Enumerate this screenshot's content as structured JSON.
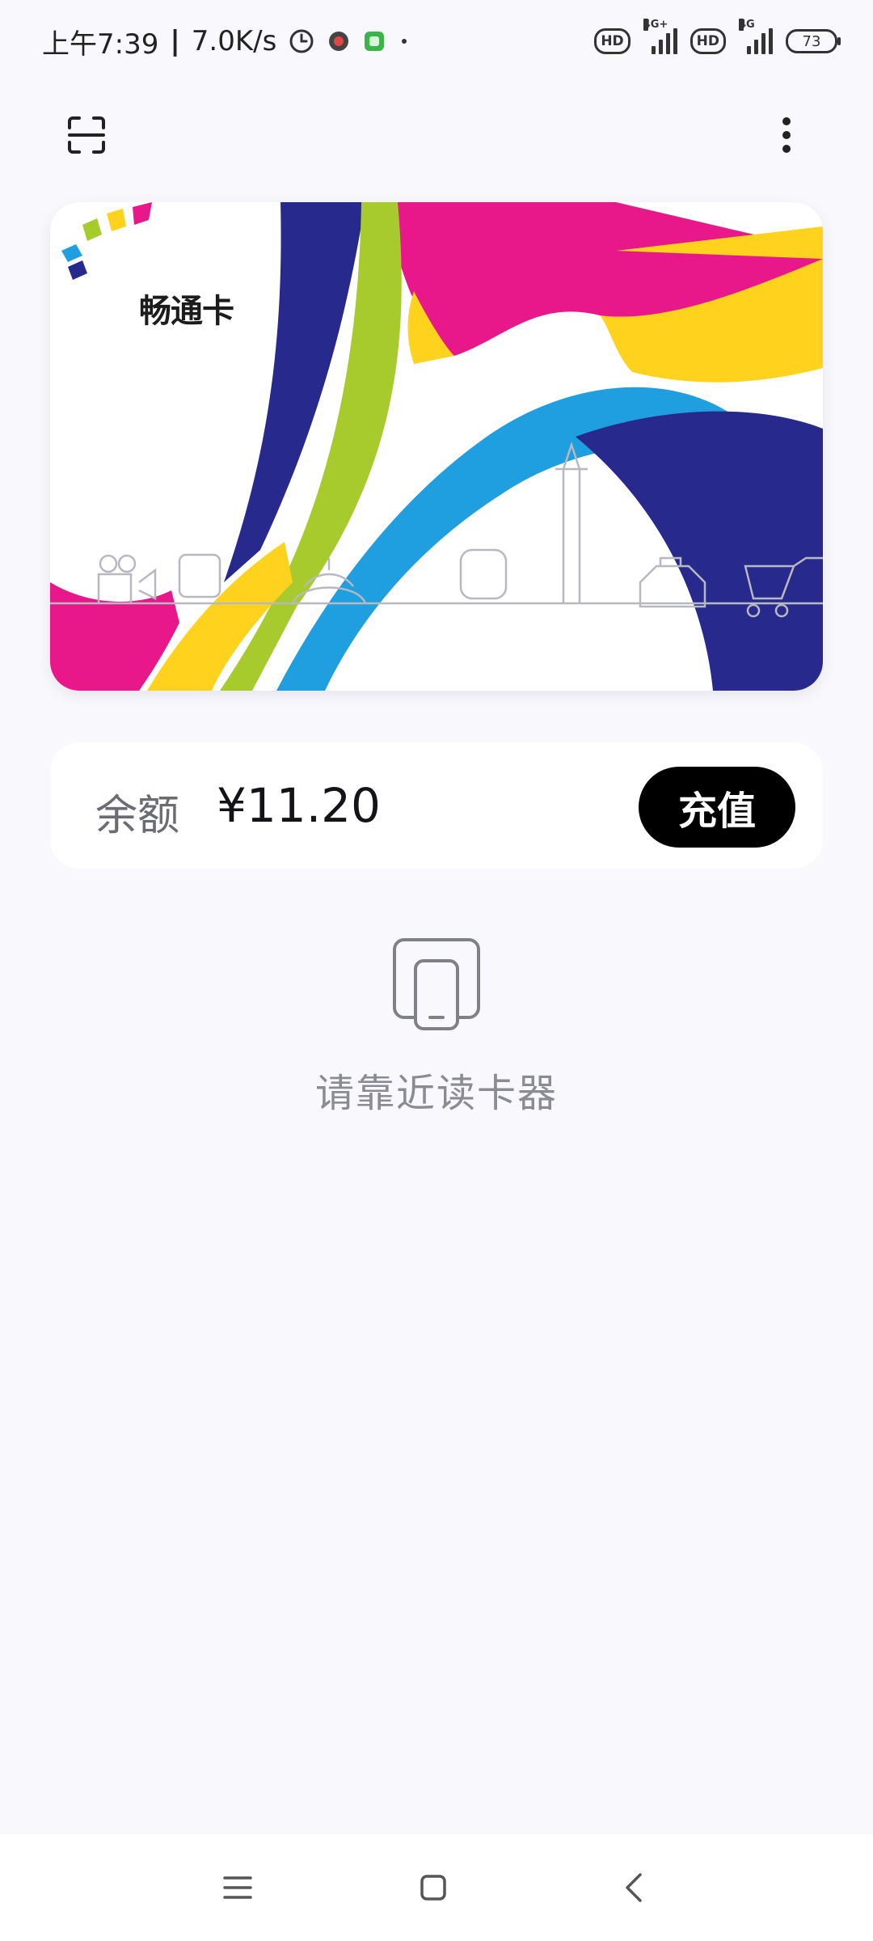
{
  "status_bar": {
    "time": "上午7:39",
    "net_speed": "7.0K/s",
    "sim1_network": "4G+",
    "sim2_network": "4G",
    "hd_label": "HD",
    "battery": "73"
  },
  "topbar": {
    "scan_icon": "scan-icon",
    "more_icon": "more-vert-icon"
  },
  "card": {
    "name": "畅通卡",
    "colors": {
      "magenta": "#e8178a",
      "yellow": "#ffd31d",
      "green": "#a7cb2d",
      "blue": "#1f9fdf",
      "navy": "#272a8c"
    }
  },
  "balance": {
    "label": "余额",
    "amount": "¥11.20",
    "recharge_label": "充值"
  },
  "nfc_hint": {
    "icon": "phone-tap-icon",
    "text": "请靠近读卡器"
  },
  "navbar": {
    "menu_icon": "menu-icon",
    "home_icon": "home-icon",
    "back_icon": "back-icon"
  }
}
